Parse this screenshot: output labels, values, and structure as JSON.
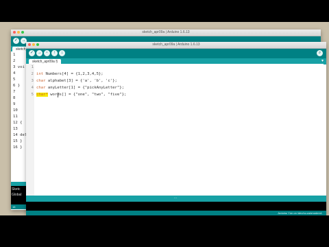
{
  "back_window": {
    "title": "sketch_apr09a | Arduino 1.6.13",
    "tab_label": "sketch_",
    "line_numbers": [
      "1",
      "2",
      "3",
      "4",
      "5",
      "6",
      "7",
      "8",
      "9",
      "10",
      "11",
      "12",
      "13",
      "14",
      "15",
      "16"
    ],
    "gutter_fragments": [
      "1",
      "2",
      "3 voi",
      "4",
      "5",
      "6 }",
      "7",
      "8",
      "9",
      "10",
      "11",
      "12 {",
      "13",
      "14 del",
      "15 }",
      "16 }"
    ],
    "console_lines": [
      "Sketc",
      "Global"
    ],
    "status_line": "16"
  },
  "front_window": {
    "title": "sketch_apr09a | Arduino 1.6.13",
    "toolbar": {
      "verify_label": "✓",
      "upload_label": "→",
      "new_label": "▫",
      "open_label": "↑",
      "save_label": "↓",
      "serial_label": "⌕"
    },
    "tab_label": "sketch_apr09a §",
    "tab_menu": "▾",
    "line_numbers": [
      "1",
      "2",
      "3",
      "4",
      "5"
    ],
    "code": [
      {
        "pre": "",
        "kw": "",
        "rest": ""
      },
      {
        "pre": "",
        "kw": "int",
        "rest": " Numbers[4] = {1,2,3,4,5};"
      },
      {
        "pre": "",
        "kw": "char",
        "rest": " alphabet[3] = {'a', 'b', 'c'};"
      },
      {
        "pre": "",
        "kw": "char",
        "rest": " anyLetter[1] = {\"pickAnyLetter\"};"
      },
      {
        "pre": "",
        "kw": "char*",
        "rest": " words[] = {\"one\", \"two\", \"five\"};"
      }
    ],
    "status_right": "Arduino Yún on /dev/cu.usbmodem1"
  },
  "colors": {
    "toolbar": "#008184",
    "tabbar": "#17a1a5",
    "keyword": "#cc6633",
    "highlight": "#f5e800",
    "console": "#000000",
    "desktop": "#c9bfa9"
  }
}
